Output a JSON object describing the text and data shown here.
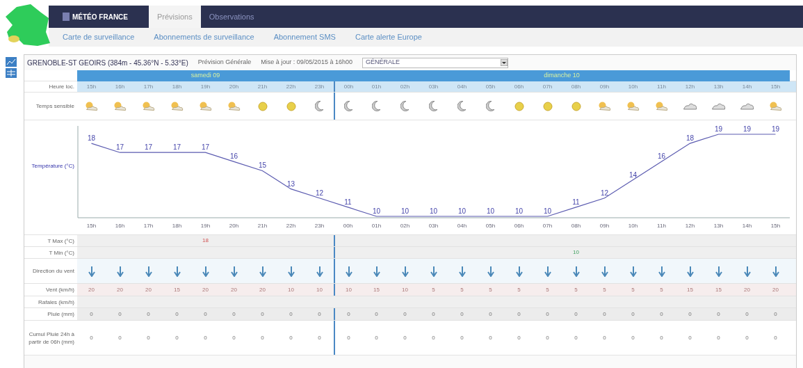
{
  "header": {
    "logo": "MÉTÉO FRANCE",
    "tabs": [
      {
        "label": "Prévisions",
        "selected": true
      },
      {
        "label": "Observations",
        "selected": false
      }
    ]
  },
  "subnav": [
    "Carte de surveillance",
    "Abonnements de surveillance",
    "Abonnement SMS",
    "Carte alerte Europe"
  ],
  "station": {
    "title": "GRENOBLE-ST GEOIRS (384m - 45.36°N - 5.33°E)",
    "forecast_label": "Prévision Générale",
    "update_label": "Mise à jour : 09/05/2015 à 16h00",
    "select_value": "GÉNÉRALE"
  },
  "row_labels": {
    "hours": "Heure loc.",
    "weather": "Temps sensible",
    "tmax": "T Max (°C)",
    "tmin": "T Min (°C)",
    "wind_dir": "Direction du vent",
    "wind_speed": "Vent (km/h)",
    "gusts": "Rafales (km/h)",
    "rain": "Pluie (mm)",
    "cumul": "Cumul Pluie 24h à partir de 06h (mm)"
  },
  "days": [
    {
      "label": "samedi 09",
      "hours": [
        {
          "hour": "15h",
          "weather": {
            "kind": "partly"
          },
          "wind_speed": "20",
          "rain": "0",
          "cumul": "0"
        },
        {
          "hour": "16h",
          "weather": {
            "kind": "partly"
          },
          "wind_speed": "20",
          "rain": "0",
          "cumul": "0"
        },
        {
          "hour": "17h",
          "weather": {
            "kind": "partly"
          },
          "wind_speed": "20",
          "rain": "0",
          "cumul": "0"
        },
        {
          "hour": "18h",
          "weather": {
            "kind": "partly"
          },
          "wind_speed": "15",
          "rain": "0",
          "cumul": "0"
        },
        {
          "hour": "19h",
          "weather": {
            "kind": "partly"
          },
          "wind_speed": "20",
          "rain": "0",
          "cumul": "0",
          "tmax": "18"
        },
        {
          "hour": "20h",
          "weather": {
            "kind": "partly"
          },
          "wind_speed": "20",
          "rain": "0",
          "cumul": "0"
        },
        {
          "hour": "21h",
          "weather": {
            "kind": "sun"
          },
          "wind_speed": "20",
          "rain": "0",
          "cumul": "0"
        },
        {
          "hour": "22h",
          "weather": {
            "kind": "sun"
          },
          "wind_speed": "10",
          "rain": "0",
          "cumul": "0"
        },
        {
          "hour": "23h",
          "weather": {
            "kind": "moon"
          },
          "wind_speed": "10",
          "rain": "0",
          "cumul": "0"
        }
      ]
    },
    {
      "label": "dimanche 10",
      "hours": [
        {
          "hour": "00h",
          "weather": {
            "kind": "moon"
          },
          "wind_speed": "10",
          "rain": "0",
          "cumul": "0"
        },
        {
          "hour": "01h",
          "weather": {
            "kind": "moon"
          },
          "wind_speed": "15",
          "rain": "0",
          "cumul": "0"
        },
        {
          "hour": "02h",
          "weather": {
            "kind": "moon"
          },
          "wind_speed": "10",
          "rain": "0",
          "cumul": "0"
        },
        {
          "hour": "03h",
          "weather": {
            "kind": "moon"
          },
          "wind_speed": "5",
          "rain": "0",
          "cumul": "0"
        },
        {
          "hour": "04h",
          "weather": {
            "kind": "moon"
          },
          "wind_speed": "5",
          "rain": "0",
          "cumul": "0"
        },
        {
          "hour": "05h",
          "weather": {
            "kind": "moon"
          },
          "wind_speed": "5",
          "rain": "0",
          "cumul": "0"
        },
        {
          "hour": "06h",
          "weather": {
            "kind": "sun"
          },
          "wind_speed": "5",
          "rain": "0",
          "cumul": "0"
        },
        {
          "hour": "07h",
          "weather": {
            "kind": "sun"
          },
          "wind_speed": "5",
          "rain": "0",
          "cumul": "0"
        },
        {
          "hour": "08h",
          "weather": {
            "kind": "sun"
          },
          "wind_speed": "5",
          "rain": "0",
          "cumul": "0",
          "tmin": "10"
        },
        {
          "hour": "09h",
          "weather": {
            "kind": "partly"
          },
          "wind_speed": "5",
          "rain": "0",
          "cumul": "0"
        },
        {
          "hour": "10h",
          "weather": {
            "kind": "partly"
          },
          "wind_speed": "5",
          "rain": "0",
          "cumul": "0"
        },
        {
          "hour": "11h",
          "weather": {
            "kind": "partly"
          },
          "wind_speed": "5",
          "rain": "0",
          "cumul": "0"
        },
        {
          "hour": "12h",
          "weather": {
            "kind": "cloud"
          },
          "wind_speed": "15",
          "rain": "0",
          "cumul": "0"
        },
        {
          "hour": "13h",
          "weather": {
            "kind": "cloud"
          },
          "wind_speed": "15",
          "rain": "0",
          "cumul": "0"
        },
        {
          "hour": "14h",
          "weather": {
            "kind": "cloud"
          },
          "wind_speed": "20",
          "rain": "0",
          "cumul": "0"
        },
        {
          "hour": "15h",
          "weather": {
            "kind": "partly"
          },
          "wind_speed": "20",
          "rain": "0",
          "cumul": "0"
        }
      ]
    }
  ],
  "chart": {
    "chart_data": {
      "type": "line",
      "categories": [
        "15h",
        "16h",
        "17h",
        "18h",
        "19h",
        "20h",
        "21h",
        "22h",
        "23h",
        "00h",
        "01h",
        "02h",
        "03h",
        "04h",
        "05h",
        "06h",
        "07h",
        "08h",
        "09h",
        "10h",
        "11h",
        "12h",
        "13h",
        "14h",
        "15h"
      ],
      "series": [
        {
          "name": "Température (°C)",
          "color": "#5b5bb0",
          "values": [
            18,
            17,
            17,
            17,
            17,
            16,
            15,
            13,
            12,
            11,
            10,
            10,
            10,
            10,
            10,
            10,
            10,
            11,
            12,
            14,
            16,
            18,
            19,
            19,
            19
          ]
        }
      ],
      "data_labels": true
    }
  }
}
